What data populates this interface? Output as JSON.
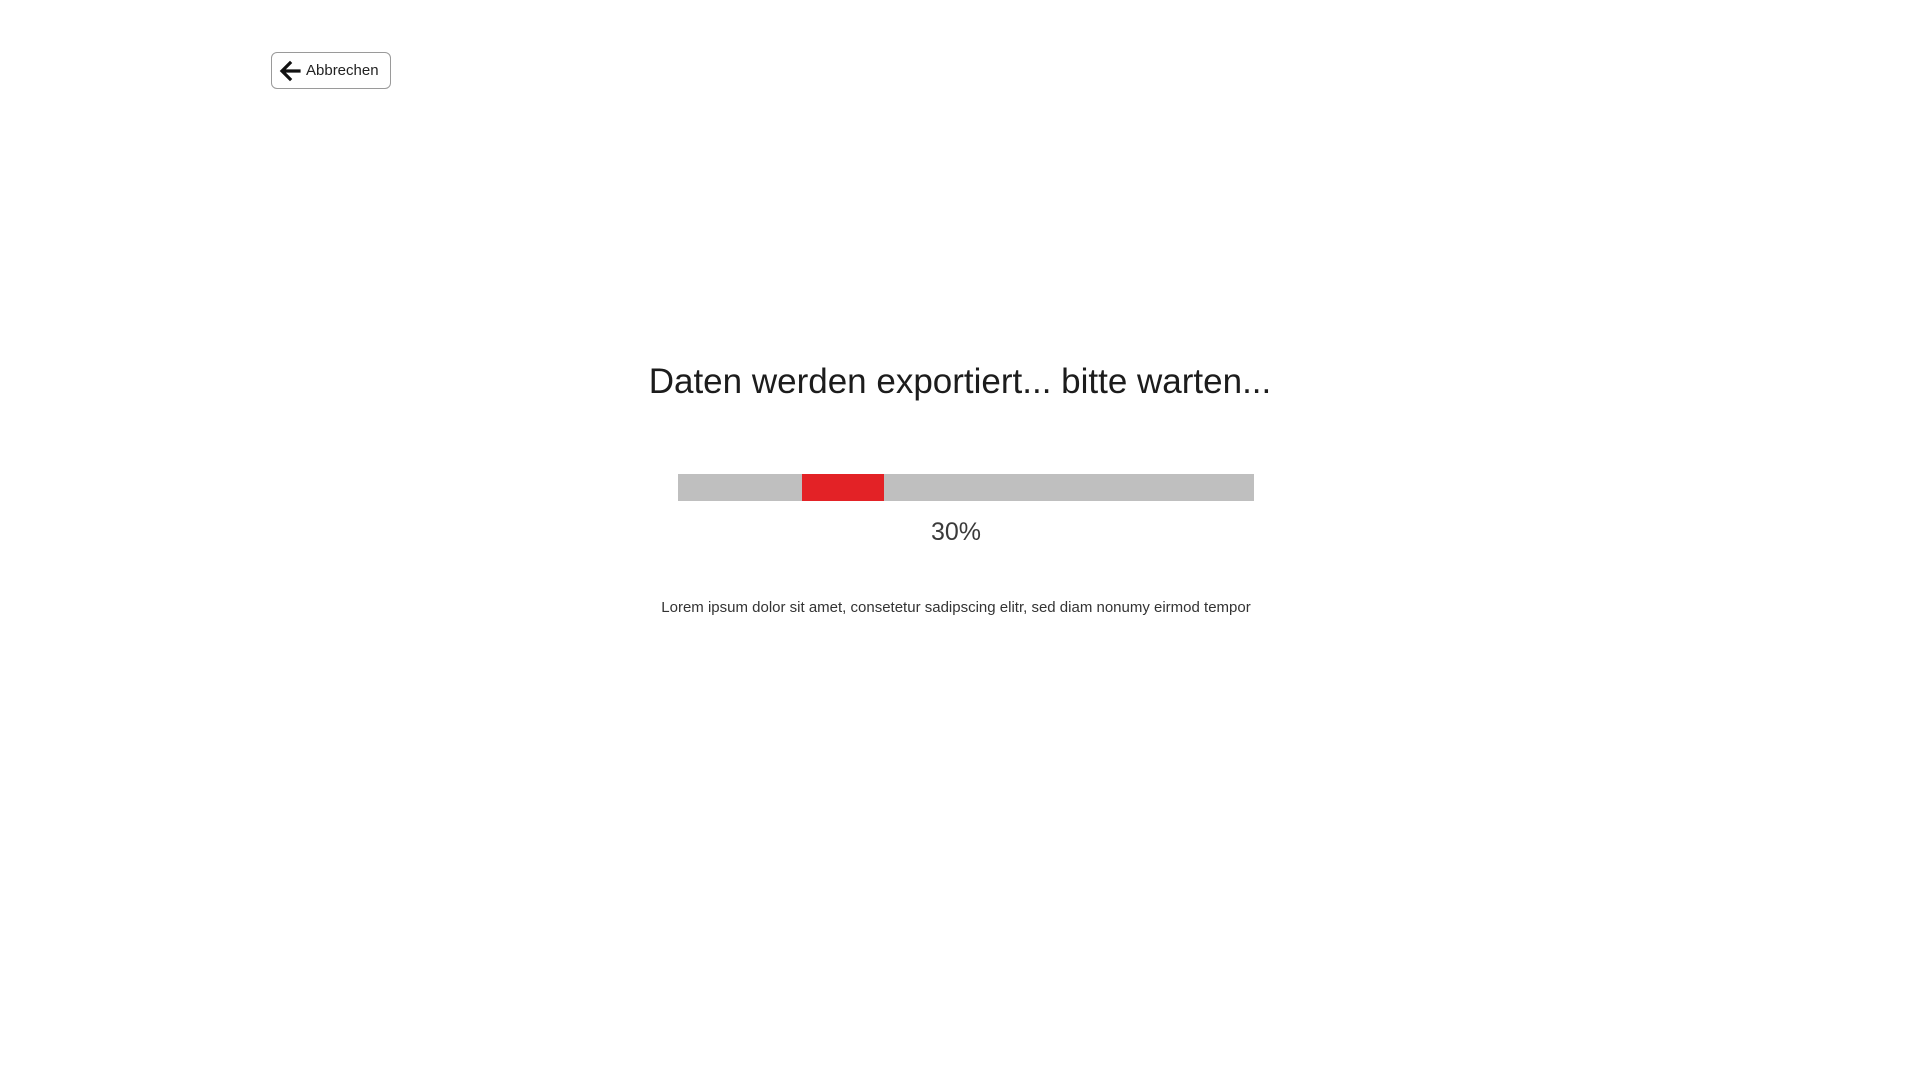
{
  "toolbar": {
    "cancel_label": "Abbrechen",
    "cancel_icon": "arrow-left-icon"
  },
  "main": {
    "heading": "Daten werden exportiert... bitte warten...",
    "progress": {
      "value_percent": 30,
      "label": "30%",
      "track_color": "#bfbfbf",
      "fill_color": "#e32226"
    },
    "description": "Lorem ipsum dolor sit amet, consetetur sadipscing elitr, sed diam nonumy eirmod tempor"
  }
}
